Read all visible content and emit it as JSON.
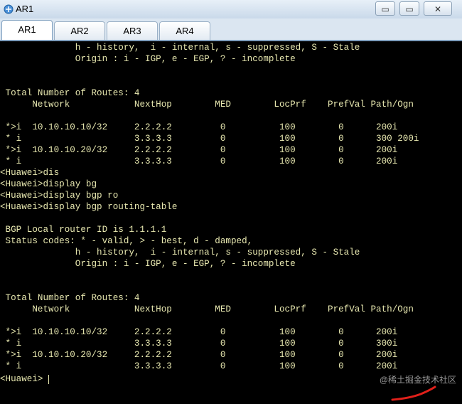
{
  "window": {
    "title": "AR1",
    "minimize_symbol": "▭",
    "restore_symbol": "▭",
    "close_symbol": "✕"
  },
  "tabs": [
    {
      "label": "AR1",
      "active": true
    },
    {
      "label": "AR2",
      "active": false
    },
    {
      "label": "AR3",
      "active": false
    },
    {
      "label": "AR4",
      "active": false
    }
  ],
  "terminal": {
    "lines": [
      "              h - history,  i - internal, s - suppressed, S - Stale",
      "              Origin : i - IGP, e - EGP, ? - incomplete",
      "",
      "",
      " Total Number of Routes: 4",
      "      Network            NextHop        MED        LocPrf    PrefVal Path/Ogn",
      "",
      " *>i  10.10.10.10/32     2.2.2.2         0          100        0      200i",
      " * i                     3.3.3.3         0          100        0      300 200i",
      " *>i  10.10.10.20/32     2.2.2.2         0          100        0      200i",
      " * i                     3.3.3.3         0          100        0      200i",
      "<Huawei>dis",
      "<Huawei>display bg",
      "<Huawei>display bgp ro",
      "<Huawei>display bgp routing-table",
      "",
      " BGP Local router ID is 1.1.1.1",
      " Status codes: * - valid, > - best, d - damped,",
      "              h - history,  i - internal, s - suppressed, S - Stale",
      "              Origin : i - IGP, e - EGP, ? - incomplete",
      "",
      "",
      " Total Number of Routes: 4",
      "      Network            NextHop        MED        LocPrf    PrefVal Path/Ogn",
      "",
      " *>i  10.10.10.10/32     2.2.2.2         0          100        0      200i",
      " * i                     3.3.3.3         0          100        0      300i",
      " *>i  10.10.10.20/32     2.2.2.2         0          100        0      200i",
      " * i                     3.3.3.3         0          100        0      200i",
      "<Huawei>"
    ]
  },
  "watermark": "@稀土掘金技术社区",
  "colors": {
    "terminal_bg": "#000000",
    "terminal_text": "#e8e8b0",
    "annotation_red": "#e0201a"
  }
}
